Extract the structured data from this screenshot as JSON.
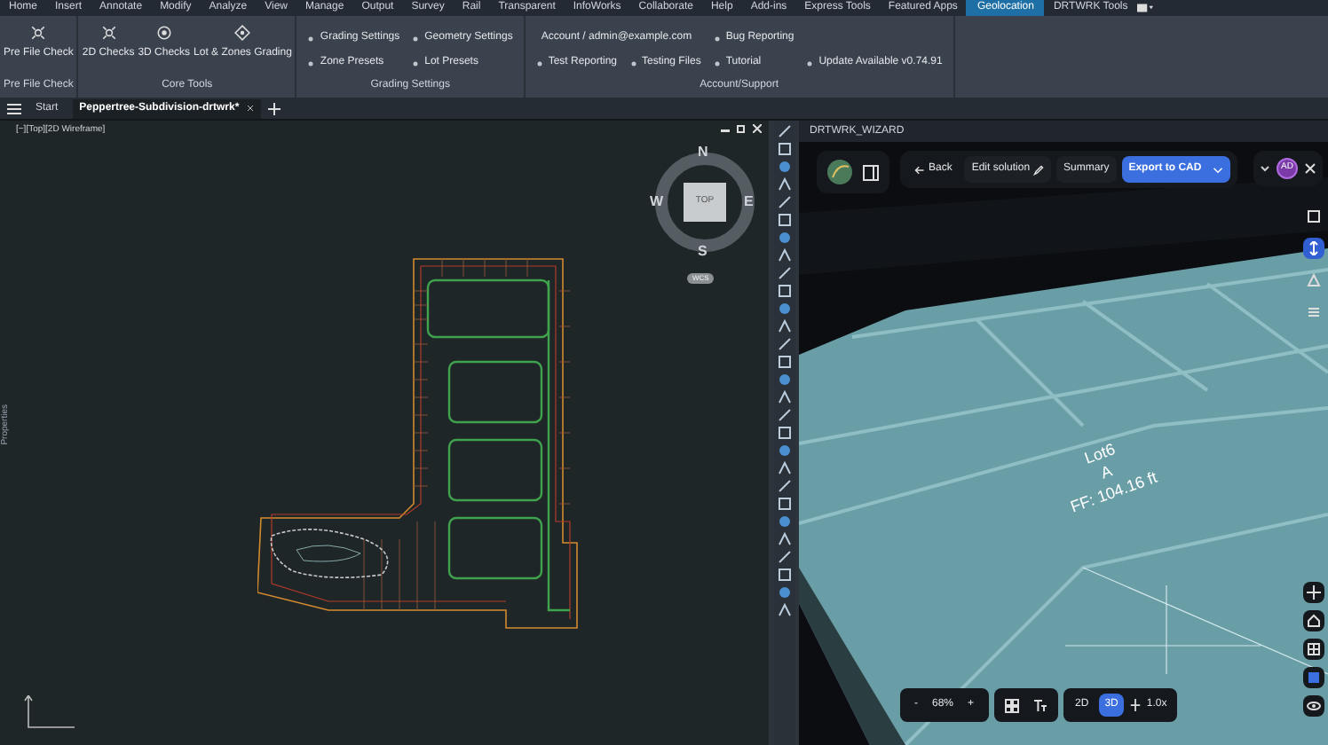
{
  "menu_tabs": [
    {
      "label": "Home",
      "selected": false
    },
    {
      "label": "Insert",
      "selected": false
    },
    {
      "label": "Annotate",
      "selected": false
    },
    {
      "label": "Modify",
      "selected": false
    },
    {
      "label": "Analyze",
      "selected": false
    },
    {
      "label": "View",
      "selected": false
    },
    {
      "label": "Manage",
      "selected": false
    },
    {
      "label": "Output",
      "selected": false
    },
    {
      "label": "Survey",
      "selected": false
    },
    {
      "label": "Rail",
      "selected": false
    },
    {
      "label": "Transparent",
      "selected": false
    },
    {
      "label": "InfoWorks",
      "selected": false
    },
    {
      "label": "Collaborate",
      "selected": false
    },
    {
      "label": "Help",
      "selected": false
    },
    {
      "label": "Add-ins",
      "selected": false
    },
    {
      "label": "Express Tools",
      "selected": false
    },
    {
      "label": "Featured Apps",
      "selected": false
    },
    {
      "label": "Geolocation",
      "selected": true
    },
    {
      "label": "DRTWRK Tools",
      "selected": false
    }
  ],
  "ribbon_groups": [
    {
      "title": "Pre File Check",
      "kind": "large",
      "buttons": [
        "Pre File Check"
      ]
    },
    {
      "title": "Core Tools",
      "kind": "large",
      "buttons": [
        "2D Checks",
        "3D Checks",
        "Lot & Zones Grading"
      ]
    },
    {
      "title": "Grading Settings",
      "kind": "small",
      "rows": [
        [
          "Grading Settings",
          "Geometry Settings"
        ],
        [
          "Zone Presets",
          "Lot Presets"
        ]
      ]
    },
    {
      "title": "Account/Support",
      "kind": "small",
      "rows": [
        [
          "Account / admin@example.com",
          "",
          "Bug Reporting"
        ],
        [
          "Test Reporting",
          "Testing Files",
          "Tutorial",
          "Update Available v0.74.91"
        ]
      ]
    }
  ],
  "doc_tabs": [
    {
      "label": "Start",
      "selected": false
    },
    {
      "label": "Peppertree-Subdivision-drtwrk*",
      "selected": true
    }
  ],
  "viewport": {
    "label": "[−][Top][2D Wireframe]",
    "side_label": "Properties",
    "viewcube": {
      "face": "TOP",
      "north": "N",
      "south": "S",
      "east": "E",
      "west": "W",
      "ucs": "WCS"
    }
  },
  "wizard": {
    "title": "DRTWRK_WIZARD",
    "back": "Back",
    "edit": "Edit solution",
    "summary": "Summary",
    "export": "Export to CAD",
    "avatar": "AD",
    "lot_label": {
      "name": "Lot6",
      "zone": "A",
      "floor": "FF: 104.16 ft"
    },
    "zoom": "68%",
    "zoom_out": "-",
    "zoom_in": "+",
    "view_modes": [
      {
        "label": "2D",
        "selected": false
      },
      {
        "label": "3D",
        "selected": true
      }
    ],
    "scale": "1.0x"
  }
}
